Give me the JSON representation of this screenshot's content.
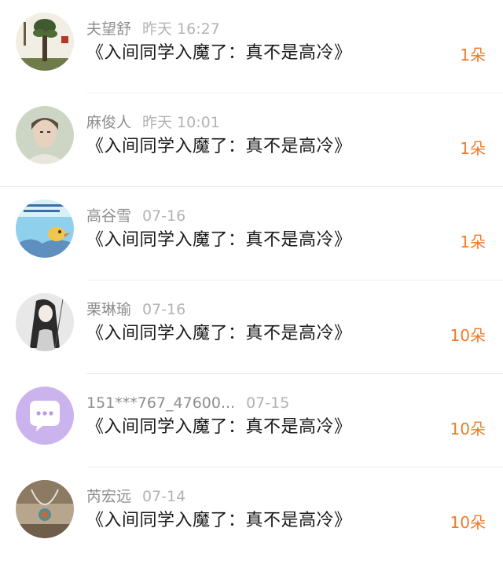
{
  "colors": {
    "gift_accent": "#f07a2a",
    "username": "#8e8e8e",
    "timestamp": "#b3b3b3",
    "content": "#1a1a1a",
    "divider": "#eeeeee"
  },
  "items": [
    {
      "username": "夫望舒",
      "time": "昨天 16:27",
      "content": "《入间同学入魔了：真不是高冷》",
      "gift": "1朵",
      "avatar_icon": "tree-painting-avatar"
    },
    {
      "username": "麻俊人",
      "time": "昨天 10:01",
      "content": "《入间同学入魔了：真不是高冷》",
      "gift": "1朵",
      "avatar_icon": "portrait-photo-avatar"
    },
    {
      "username": "高谷雪",
      "time": "07-16",
      "content": "《入间同学入魔了：真不是高冷》",
      "gift": "1朵",
      "avatar_icon": "cartoon-bird-avatar"
    },
    {
      "username": "栗琳瑜",
      "time": "07-16",
      "content": "《入间同学入魔了：真不是高冷》",
      "gift": "10朵",
      "avatar_icon": "ink-drawing-avatar"
    },
    {
      "username": "151***767_47600...",
      "time": "07-15",
      "content": "《入间同学入魔了：真不是高冷》",
      "gift": "10朵",
      "avatar_icon": "chat-bubble-default-avatar"
    },
    {
      "username": "芮宏远",
      "time": "07-14",
      "content": "《入间同学入魔了：真不是高冷》",
      "gift": "10朵",
      "avatar_icon": "necklace-photo-avatar"
    }
  ]
}
